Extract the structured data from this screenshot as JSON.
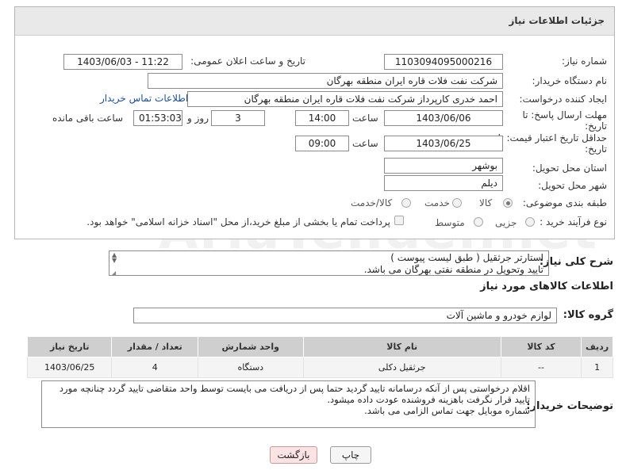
{
  "panel": {
    "title": "جزئیات اطلاعات نیاز"
  },
  "fields": {
    "need_number_label": "شماره نیاز:",
    "need_number": "1103094095000216",
    "announce_label": "تاریخ و ساعت اعلان عمومی:",
    "announce_value": "1403/06/03 - 11:22",
    "buyer_label": "نام دستگاه خریدار:",
    "buyer_value": "شرکت نفت فلات قاره ایران منطقه بهرگان",
    "creator_label": "ایجاد کننده درخواست:",
    "creator_value": "احمد خدری کارپرداز شرکت نفت فلات قاره ایران منطقه بهرگان",
    "contact_link": "اطلاعات تماس خریدار",
    "deadline_label_1": "مهلت ارسال پاسخ: تا",
    "deadline_label_2": "تاریخ:",
    "deadline_date": "1403/06/06",
    "time_label": "ساعت",
    "deadline_time": "14:00",
    "days_value": "3",
    "days_label": "روز و",
    "remaining_time": "01:53:03",
    "remaining_label": "ساعت باقی مانده",
    "validity_label_1": "حداقل تاریخ اعتبار قیمت: تا",
    "validity_label_2": "تاریخ:",
    "validity_date": "1403/06/25",
    "validity_time_label": "ساعت",
    "validity_time": "09:00",
    "province_label": "استان محل تحویل:",
    "province_value": "بوشهر",
    "city_label": "شهر محل تحویل:",
    "city_value": "دیلم",
    "category_label": "طبقه بندی موضوعی:",
    "category_options": [
      "کالا",
      "خدمت",
      "کالا/خدمت"
    ],
    "category_selected": "کالا",
    "process_label": "نوع فرآیند خرید :",
    "process_options": [
      "جزیی",
      "متوسط"
    ],
    "payment_text": "پرداخت تمام یا بخشی از مبلغ خرید،از محل \"اسناد خزانه اسلامی\" خواهد بود."
  },
  "description": {
    "label": "شرح کلی نیاز:",
    "line1": "استارتر جرثقیل ( طبق لیست پیوست )",
    "line2": "تایید وتحویل در منطقه نفتی بهرگان می باشد."
  },
  "goods": {
    "section_title": "اطلاعات کالاهای مورد نیاز",
    "group_label": "گروه کالا:",
    "group_value": "لوازم خودرو و ماشین آلات",
    "columns": [
      "ردیف",
      "کد کالا",
      "نام کالا",
      "واحد شمارش",
      "تعداد / مقدار",
      "تاریخ نیاز"
    ],
    "rows": [
      {
        "row": "1",
        "code": "--",
        "name": "جرثقیل دکلی",
        "unit": "دستگاه",
        "qty": "4",
        "date": "1403/06/25"
      }
    ]
  },
  "buyer_notes": {
    "label": "توضیحات خریدار:",
    "line1": "اقلام درخواستی پس از آنکه درسامانه تایید گردید حتما پس از دریافت می بایست توسط واحد متقاضی تایید گردد چنانچه مورد",
    "line2": "تایید قرار نگرفت باهزینه فروشنده عودت داده میشود.",
    "line3": "شماره موبایل جهت تماس الزامی می باشد."
  },
  "buttons": {
    "print": "چاپ",
    "back": "بازگشت"
  },
  "colors": {
    "accent_link": "#1a4fa0",
    "back_button_bg": "#fbe3e3",
    "table_header": "#cfcfcf"
  }
}
